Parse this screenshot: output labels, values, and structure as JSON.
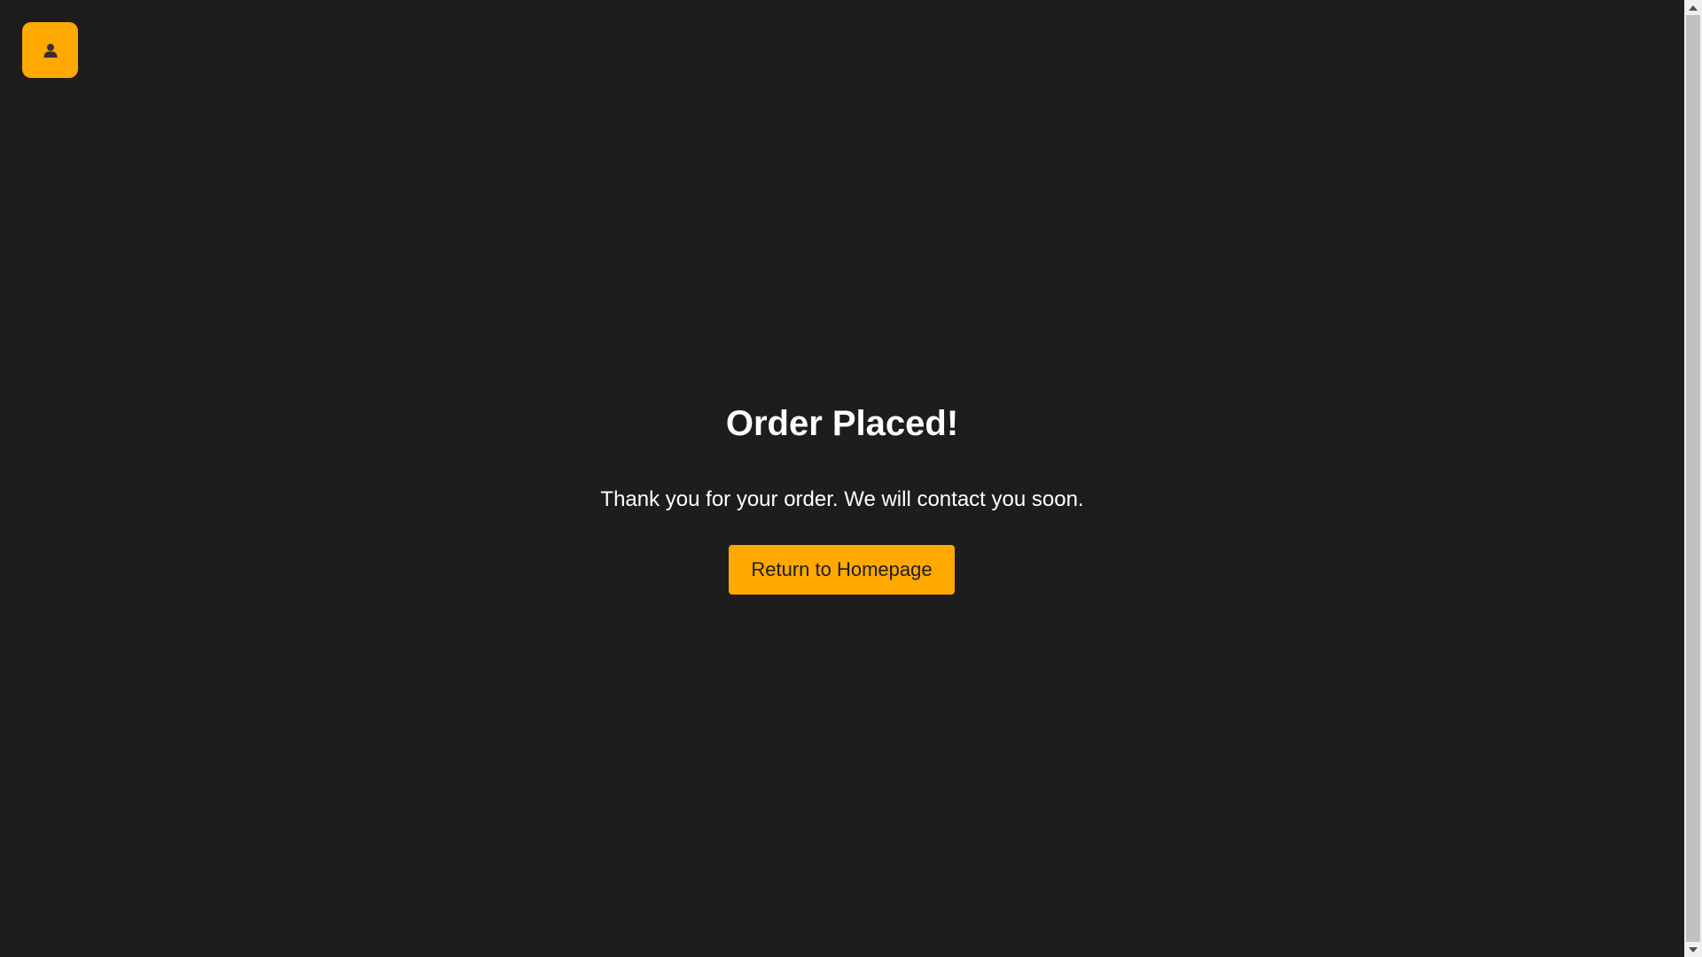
{
  "header": {
    "profile_icon": "user-icon",
    "accent_color": "#ffa800"
  },
  "main": {
    "title": "Order Placed!",
    "message": "Thank you for your order. We will contact you soon.",
    "return_button_label": "Return to Homepage"
  },
  "theme": {
    "background": "#1d1d1d",
    "text": "#ffffff"
  }
}
